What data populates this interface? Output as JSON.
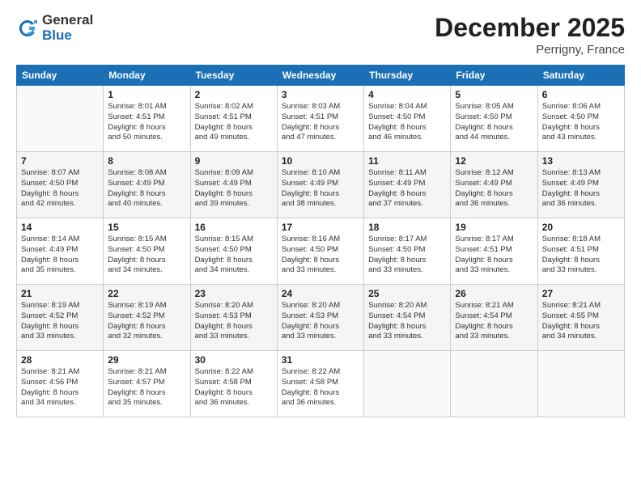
{
  "logo": {
    "general": "General",
    "blue": "Blue"
  },
  "title": "December 2025",
  "location": "Perrigny, France",
  "weekdays": [
    "Sunday",
    "Monday",
    "Tuesday",
    "Wednesday",
    "Thursday",
    "Friday",
    "Saturday"
  ],
  "weeks": [
    [
      {
        "day": "",
        "info": ""
      },
      {
        "day": "1",
        "info": "Sunrise: 8:01 AM\nSunset: 4:51 PM\nDaylight: 8 hours\nand 50 minutes."
      },
      {
        "day": "2",
        "info": "Sunrise: 8:02 AM\nSunset: 4:51 PM\nDaylight: 8 hours\nand 49 minutes."
      },
      {
        "day": "3",
        "info": "Sunrise: 8:03 AM\nSunset: 4:51 PM\nDaylight: 8 hours\nand 47 minutes."
      },
      {
        "day": "4",
        "info": "Sunrise: 8:04 AM\nSunset: 4:50 PM\nDaylight: 8 hours\nand 46 minutes."
      },
      {
        "day": "5",
        "info": "Sunrise: 8:05 AM\nSunset: 4:50 PM\nDaylight: 8 hours\nand 44 minutes."
      },
      {
        "day": "6",
        "info": "Sunrise: 8:06 AM\nSunset: 4:50 PM\nDaylight: 8 hours\nand 43 minutes."
      }
    ],
    [
      {
        "day": "7",
        "info": "Sunrise: 8:07 AM\nSunset: 4:50 PM\nDaylight: 8 hours\nand 42 minutes."
      },
      {
        "day": "8",
        "info": "Sunrise: 8:08 AM\nSunset: 4:49 PM\nDaylight: 8 hours\nand 40 minutes."
      },
      {
        "day": "9",
        "info": "Sunrise: 8:09 AM\nSunset: 4:49 PM\nDaylight: 8 hours\nand 39 minutes."
      },
      {
        "day": "10",
        "info": "Sunrise: 8:10 AM\nSunset: 4:49 PM\nDaylight: 8 hours\nand 38 minutes."
      },
      {
        "day": "11",
        "info": "Sunrise: 8:11 AM\nSunset: 4:49 PM\nDaylight: 8 hours\nand 37 minutes."
      },
      {
        "day": "12",
        "info": "Sunrise: 8:12 AM\nSunset: 4:49 PM\nDaylight: 8 hours\nand 36 minutes."
      },
      {
        "day": "13",
        "info": "Sunrise: 8:13 AM\nSunset: 4:49 PM\nDaylight: 8 hours\nand 36 minutes."
      }
    ],
    [
      {
        "day": "14",
        "info": "Sunrise: 8:14 AM\nSunset: 4:49 PM\nDaylight: 8 hours\nand 35 minutes."
      },
      {
        "day": "15",
        "info": "Sunrise: 8:15 AM\nSunset: 4:50 PM\nDaylight: 8 hours\nand 34 minutes."
      },
      {
        "day": "16",
        "info": "Sunrise: 8:15 AM\nSunset: 4:50 PM\nDaylight: 8 hours\nand 34 minutes."
      },
      {
        "day": "17",
        "info": "Sunrise: 8:16 AM\nSunset: 4:50 PM\nDaylight: 8 hours\nand 33 minutes."
      },
      {
        "day": "18",
        "info": "Sunrise: 8:17 AM\nSunset: 4:50 PM\nDaylight: 8 hours\nand 33 minutes."
      },
      {
        "day": "19",
        "info": "Sunrise: 8:17 AM\nSunset: 4:51 PM\nDaylight: 8 hours\nand 33 minutes."
      },
      {
        "day": "20",
        "info": "Sunrise: 8:18 AM\nSunset: 4:51 PM\nDaylight: 8 hours\nand 33 minutes."
      }
    ],
    [
      {
        "day": "21",
        "info": "Sunrise: 8:19 AM\nSunset: 4:52 PM\nDaylight: 8 hours\nand 33 minutes."
      },
      {
        "day": "22",
        "info": "Sunrise: 8:19 AM\nSunset: 4:52 PM\nDaylight: 8 hours\nand 32 minutes."
      },
      {
        "day": "23",
        "info": "Sunrise: 8:20 AM\nSunset: 4:53 PM\nDaylight: 8 hours\nand 33 minutes."
      },
      {
        "day": "24",
        "info": "Sunrise: 8:20 AM\nSunset: 4:53 PM\nDaylight: 8 hours\nand 33 minutes."
      },
      {
        "day": "25",
        "info": "Sunrise: 8:20 AM\nSunset: 4:54 PM\nDaylight: 8 hours\nand 33 minutes."
      },
      {
        "day": "26",
        "info": "Sunrise: 8:21 AM\nSunset: 4:54 PM\nDaylight: 8 hours\nand 33 minutes."
      },
      {
        "day": "27",
        "info": "Sunrise: 8:21 AM\nSunset: 4:55 PM\nDaylight: 8 hours\nand 34 minutes."
      }
    ],
    [
      {
        "day": "28",
        "info": "Sunrise: 8:21 AM\nSunset: 4:56 PM\nDaylight: 8 hours\nand 34 minutes."
      },
      {
        "day": "29",
        "info": "Sunrise: 8:21 AM\nSunset: 4:57 PM\nDaylight: 8 hours\nand 35 minutes."
      },
      {
        "day": "30",
        "info": "Sunrise: 8:22 AM\nSunset: 4:58 PM\nDaylight: 8 hours\nand 36 minutes."
      },
      {
        "day": "31",
        "info": "Sunrise: 8:22 AM\nSunset: 4:58 PM\nDaylight: 8 hours\nand 36 minutes."
      },
      {
        "day": "",
        "info": ""
      },
      {
        "day": "",
        "info": ""
      },
      {
        "day": "",
        "info": ""
      }
    ]
  ]
}
